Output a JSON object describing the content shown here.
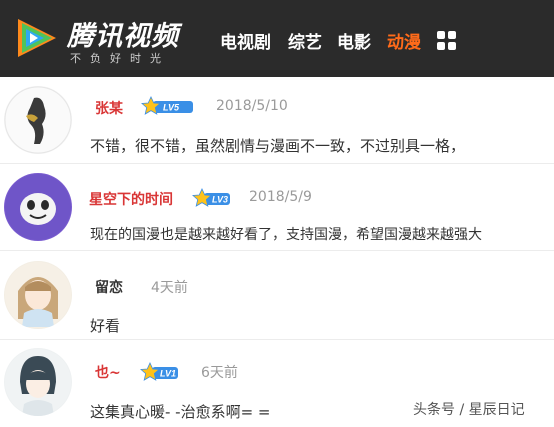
{
  "header": {
    "logo_title": "腾讯视频",
    "logo_slogan": "不负好时光",
    "nav_items": [
      {
        "label": "电视剧",
        "active": false
      },
      {
        "label": "综艺",
        "active": false
      },
      {
        "label": "电影",
        "active": false
      },
      {
        "label": "动漫",
        "active": true
      }
    ],
    "colors": {
      "bar": "#2b2b2b",
      "active": "#ff6b1a",
      "logo_orange": "#ff8a1c",
      "logo_green": "#4fc45a",
      "logo_blue": "#2fa8f2"
    }
  },
  "comments": [
    {
      "username": "张某",
      "username_color": "#d93636",
      "level": "LV5",
      "date": "2018/5/10",
      "text": "不错，很不错，虽然剧情与漫画不一致，不过别具一格，"
    },
    {
      "username": "星空下的时间",
      "username_color": "#d93636",
      "level": "LV3",
      "date": "2018/5/9",
      "text": "现在的国漫也是越来越好看了，支持国漫，希望国漫越来越强大"
    },
    {
      "username": "留恋",
      "username_color": "#333333",
      "level": "",
      "date": "4天前",
      "text": "好看"
    },
    {
      "username": "也~",
      "username_color": "#d93636",
      "level": "LV1",
      "date": "6天前",
      "text": "这集真心暖- -治愈系啊= ="
    }
  ],
  "watermark": "头条号 / 星辰日记"
}
